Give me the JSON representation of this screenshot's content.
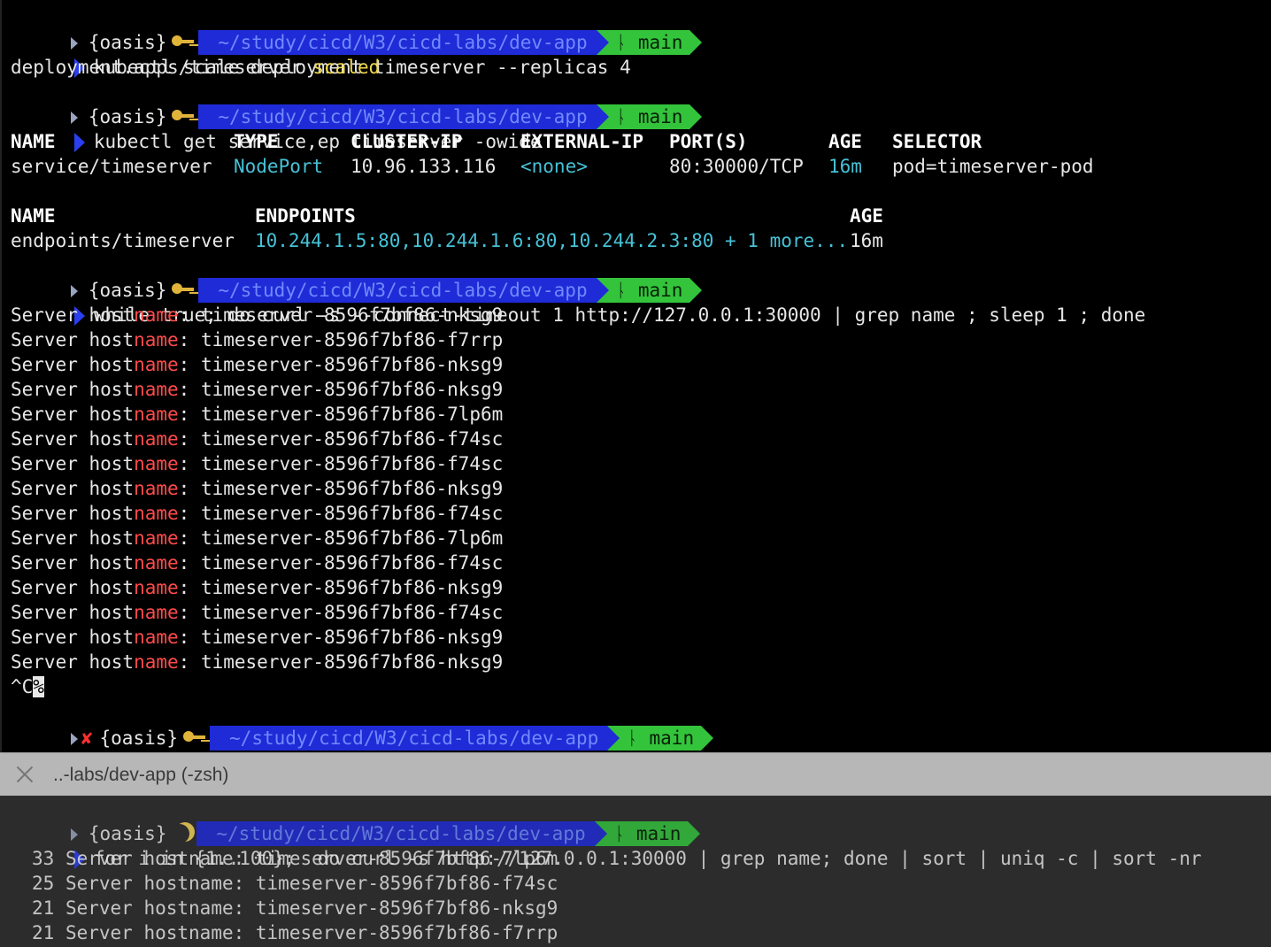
{
  "prompt": {
    "user": "{oasis}",
    "path": "~/study/cicd/W3/cicd-labs/dev-app",
    "branch_icon": "git-branch-icon",
    "branch": "main",
    "key_icon": "key-icon",
    "moon_icon": "moon-icon",
    "error_mark": "✘"
  },
  "top": {
    "cmd1": "kubectl scale deployment timeserver --replicas 4",
    "out1_prefix": "deployment.apps/timeserver ",
    "out1_status": "scaled",
    "cmd2": "kubectl get service,ep timeserver -owide",
    "svc_headers": [
      "NAME",
      "TYPE",
      "CLUSTER-IP",
      "EXTERNAL-IP",
      "PORT(S)",
      "AGE",
      "SELECTOR"
    ],
    "svc_row": [
      "service/timeserver",
      "NodePort",
      "10.96.133.116",
      "<none>",
      "80:30000/TCP",
      "16m",
      "pod=timeserver-pod"
    ],
    "ep_headers": [
      "NAME",
      "ENDPOINTS",
      "AGE"
    ],
    "ep_row": [
      "endpoints/timeserver",
      "10.244.1.5:80,10.244.1.6:80,10.244.2.3:80 + 1 more...",
      "16m"
    ],
    "cmd3": "while true; do curl -s --connect-timeout 1 http://127.0.0.1:30000 | grep name ; sleep 1 ; done",
    "host_prefix_a": "Server host",
    "host_prefix_b": "name",
    "host_prefix_c": ": ",
    "hosts": [
      "timeserver-8596f7bf86-nksg9",
      "timeserver-8596f7bf86-f7rrp",
      "timeserver-8596f7bf86-nksg9",
      "timeserver-8596f7bf86-nksg9",
      "timeserver-8596f7bf86-7lp6m",
      "timeserver-8596f7bf86-f74sc",
      "timeserver-8596f7bf86-f74sc",
      "timeserver-8596f7bf86-nksg9",
      "timeserver-8596f7bf86-f74sc",
      "timeserver-8596f7bf86-7lp6m",
      "timeserver-8596f7bf86-f74sc",
      "timeserver-8596f7bf86-nksg9",
      "timeserver-8596f7bf86-f74sc",
      "timeserver-8596f7bf86-nksg9",
      "timeserver-8596f7bf86-nksg9"
    ],
    "interrupt_prefix": "^C",
    "interrupt_mark": "%"
  },
  "tab": {
    "title": "..-labs/dev-app (-zsh)",
    "close_icon": "close-icon"
  },
  "bottom": {
    "cmd": "for i in {1..100};  do curl -s http://127.0.0.1:30000 | grep name; done | sort | uniq -c | sort -nr",
    "counts": [
      {
        "n": "33",
        "text": "Server hostname: timeserver-8596f7bf86-7lp6m"
      },
      {
        "n": "25",
        "text": "Server hostname: timeserver-8596f7bf86-f74sc"
      },
      {
        "n": "21",
        "text": "Server hostname: timeserver-8596f7bf86-nksg9"
      },
      {
        "n": "21",
        "text": "Server hostname: timeserver-8596f7bf86-f7rrp"
      }
    ]
  }
}
